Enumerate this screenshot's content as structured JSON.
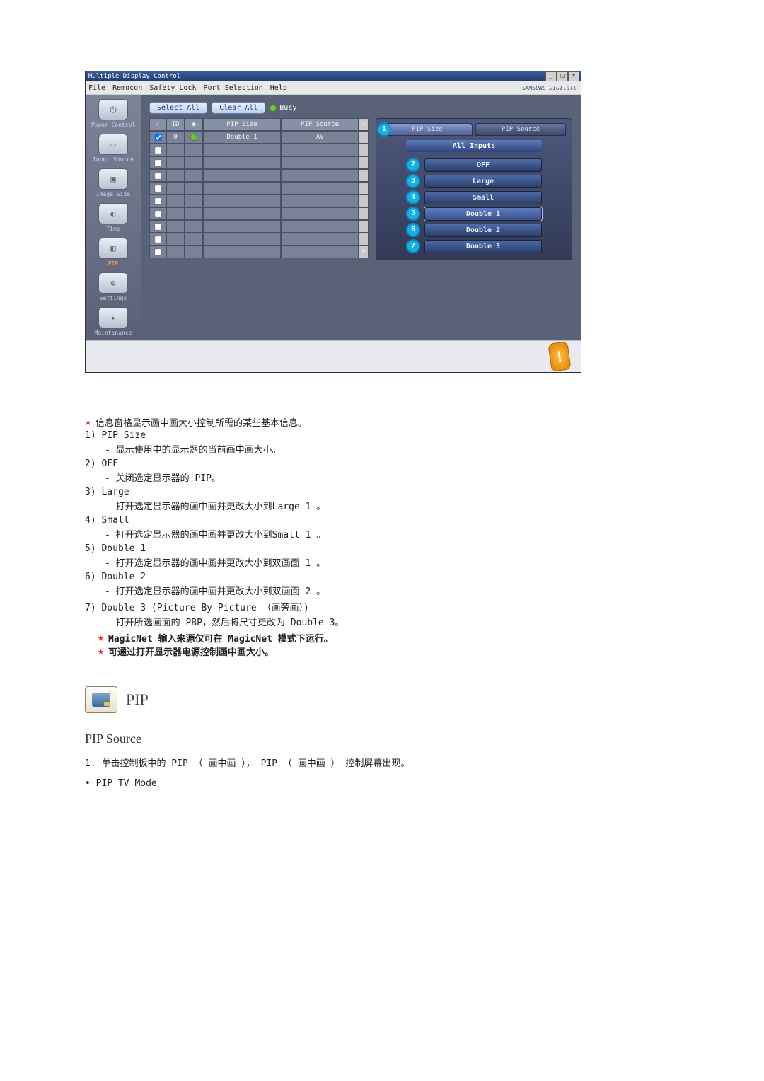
{
  "window": {
    "title": "Multiple Display Control",
    "controls": {
      "min": "_",
      "max": "□",
      "close": "×"
    }
  },
  "menu": {
    "items": [
      "File",
      "Remocon",
      "Safety Lock",
      "Port Selection",
      "Help"
    ],
    "brand": "SAMSUNG DIGITall"
  },
  "sidebar": {
    "items": [
      {
        "label": "Power Control",
        "glyph": "⏻"
      },
      {
        "label": "Input Source",
        "glyph": "▭"
      },
      {
        "label": "Image Size",
        "glyph": "▣"
      },
      {
        "label": "Time",
        "glyph": "◐"
      },
      {
        "label": "PIP",
        "glyph": "◧",
        "active": true
      },
      {
        "label": "Settings",
        "glyph": "⚙"
      },
      {
        "label": "Maintenance",
        "glyph": "✦"
      }
    ]
  },
  "toolbar": {
    "select_all": "Select All",
    "clear_all": "Clear All",
    "busy": "Busy"
  },
  "grid": {
    "headers": {
      "check": "✓",
      "id": "ID",
      "lamp": "◉",
      "pip_size": "PIP Size",
      "pip_source": "PIP Source"
    },
    "row0": {
      "id": "0",
      "pip_size": "Double 1",
      "pip_source": "AV"
    },
    "empty_rows": 9
  },
  "panel": {
    "tabs": {
      "size": "PIP Size",
      "source": "PIP Source",
      "active_num": "1"
    },
    "all_inputs": "All Inputs",
    "options": [
      {
        "num": "2",
        "label": "OFF"
      },
      {
        "num": "3",
        "label": "Large"
      },
      {
        "num": "4",
        "label": "Small"
      },
      {
        "num": "5",
        "label": "Double 1",
        "selected": true
      },
      {
        "num": "6",
        "label": "Double 2"
      },
      {
        "num": "7",
        "label": "Double 3"
      }
    ]
  },
  "footer": {
    "info_glyph": "!"
  },
  "doc": {
    "intro": "信息窗格显示画中画大小控制所需的某些基本信息。",
    "items": [
      {
        "head": "1) PIP Size",
        "sub": "- 显示使用中的显示器的当前画中画大小。"
      },
      {
        "head": "2) OFF",
        "sub": "- 关闭选定显示器的 PIP。"
      },
      {
        "head": "3) Large",
        "sub": "- 打开选定显示器的画中画并更改大小到Large 1 。"
      },
      {
        "head": "4) Small",
        "sub": "- 打开选定显示器的画中画并更改大小到Small 1 。"
      },
      {
        "head": "5) Double 1",
        "sub": "- 打开选定显示器的画中画并更改大小到双画面 1 。"
      },
      {
        "head": "6) Double 2",
        "sub": "- 打开选定显示器的画中画并更改大小到双画面 2 。"
      },
      {
        "head": "7) Double 3 (Picture By Picture （画旁画）)",
        "sub": "— 打开所选画面的 PBP，然后将尺寸更改为 Double 3。"
      }
    ],
    "notes": [
      "MagicNet 输入来源仅可在 MagicNet 模式下运行。",
      "可通过打开显示器电源控制画中画大小。"
    ]
  },
  "pip": {
    "heading": "PIP",
    "sub": "PIP Source",
    "line1": "1. 单击控制板中的 PIP （ 画中画 ），  PIP （ 画中画 ） 控制屏幕出现。",
    "line2": "• PIP TV Mode"
  }
}
